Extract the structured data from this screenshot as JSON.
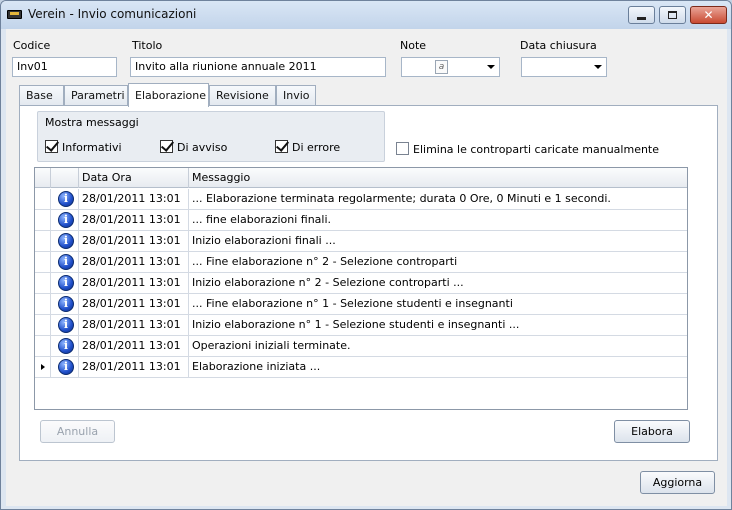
{
  "window": {
    "title": "Verein - Invio comunicazioni"
  },
  "header": {
    "codice_label": "Codice",
    "codice_value": "Inv01",
    "titolo_label": "Titolo",
    "titolo_value": "Invito alla riunione annuale 2011",
    "note_label": "Note",
    "data_chiusura_label": "Data chiusura",
    "data_chiusura_value": ""
  },
  "tabs": [
    "Base",
    "Parametri",
    "Elaborazione",
    "Revisione",
    "Invio"
  ],
  "active_tab": "Elaborazione",
  "messages_group": {
    "title": "Mostra messaggi",
    "options": [
      {
        "label": "Informativi",
        "checked": true
      },
      {
        "label": "Di avviso",
        "checked": true
      },
      {
        "label": "Di errore",
        "checked": true
      }
    ]
  },
  "elimina": {
    "label": "Elimina le controparti caricate manualmente",
    "checked": false
  },
  "grid": {
    "columns": [
      "Data Ora",
      "Messaggio"
    ],
    "rows": [
      {
        "icon": "info-icon",
        "date": "28/01/2011 13:01",
        "message": "... Elaborazione terminata regolarmente; durata 0 Ore, 0 Minuti e 1 secondi."
      },
      {
        "icon": "info-icon",
        "date": "28/01/2011 13:01",
        "message": "... fine elaborazioni finali."
      },
      {
        "icon": "info-icon",
        "date": "28/01/2011 13:01",
        "message": "Inizio elaborazioni finali ..."
      },
      {
        "icon": "info-icon",
        "date": "28/01/2011 13:01",
        "message": "... Fine elaborazione n° 2 - Selezione controparti"
      },
      {
        "icon": "info-icon",
        "date": "28/01/2011 13:01",
        "message": "Inizio elaborazione n° 2 - Selezione controparti ..."
      },
      {
        "icon": "info-icon",
        "date": "28/01/2011 13:01",
        "message": "... Fine elaborazione n° 1 - Selezione studenti e insegnanti"
      },
      {
        "icon": "info-icon",
        "date": "28/01/2011 13:01",
        "message": "Inizio elaborazione n° 1 - Selezione studenti e insegnanti ..."
      },
      {
        "icon": "info-icon",
        "date": "28/01/2011 13:01",
        "message": "Operazioni iniziali terminate."
      },
      {
        "icon": "info-icon",
        "date": "28/01/2011 13:01",
        "message": "Elaborazione iniziata ...",
        "current": true
      }
    ]
  },
  "buttons": {
    "annulla": "Annulla",
    "elabora": "Elabora",
    "aggiorna": "Aggiorna"
  },
  "icons": {
    "minimize": "minimize-icon",
    "maximize": "maximize-icon",
    "close": "close-icon"
  }
}
